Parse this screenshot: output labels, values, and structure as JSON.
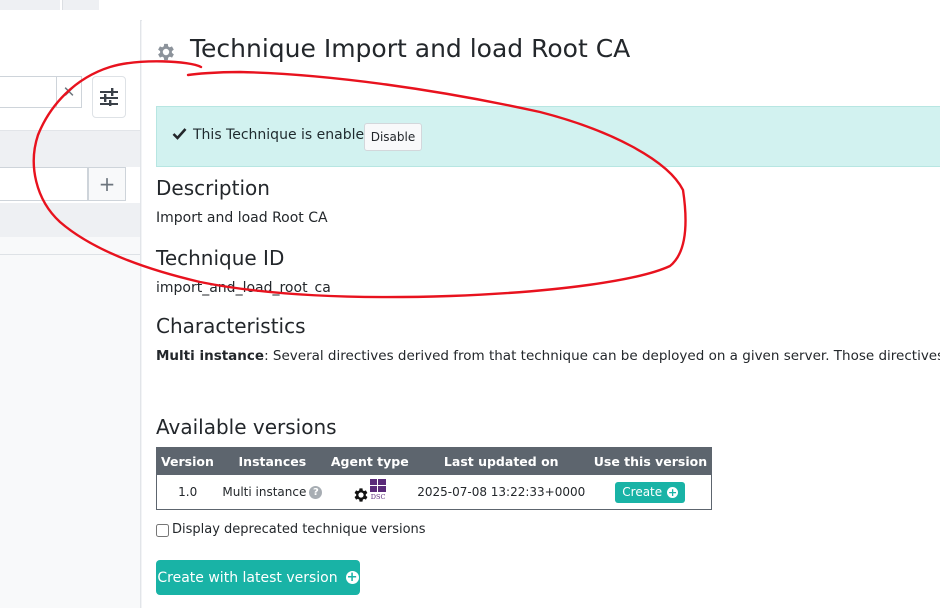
{
  "page": {
    "title": "Technique Import and load Root CA"
  },
  "status": {
    "message": "This Technique is enabled.",
    "disable_label": "Disable"
  },
  "description": {
    "heading": "Description",
    "text": "Import and load Root CA"
  },
  "technique_id": {
    "heading": "Technique ID",
    "value": "import_and_load_root_ca"
  },
  "characteristics": {
    "heading": "Characteristics",
    "term": "Multi instance",
    "text": ": Several directives derived from that technique can be deployed on a given server. Those directives can be deployed at the same time even if they have a unique limited mode. Directives from this technique version can also be used with other directives from a single limited multi instance technique."
  },
  "versions": {
    "heading": "Available versions",
    "columns": [
      "Version",
      "Instances",
      "Agent type",
      "Last updated on",
      "Use this version"
    ],
    "rows": [
      {
        "version": "1.0",
        "instances": "Multi instance",
        "agent_badge": "DSC",
        "updated": "2025-07-08 13:22:33+0000",
        "action": "Create"
      }
    ],
    "deprecated_label": "Display deprecated technique versions"
  },
  "create_latest_label": "Create with latest version",
  "icons": {
    "title": "gear-icon",
    "status": "check-icon",
    "clear": "close-icon",
    "filter": "sliders-icon",
    "add": "plus-icon",
    "help": "question-circle-icon",
    "agent": "gear-icon",
    "windows": "windows-icon",
    "create": "plus-circle-icon"
  },
  "colors": {
    "accent": "#19b3a6",
    "alert_bg": "#d2f2f0",
    "table_header": "#5d656e",
    "annotation": "#e8121e"
  }
}
